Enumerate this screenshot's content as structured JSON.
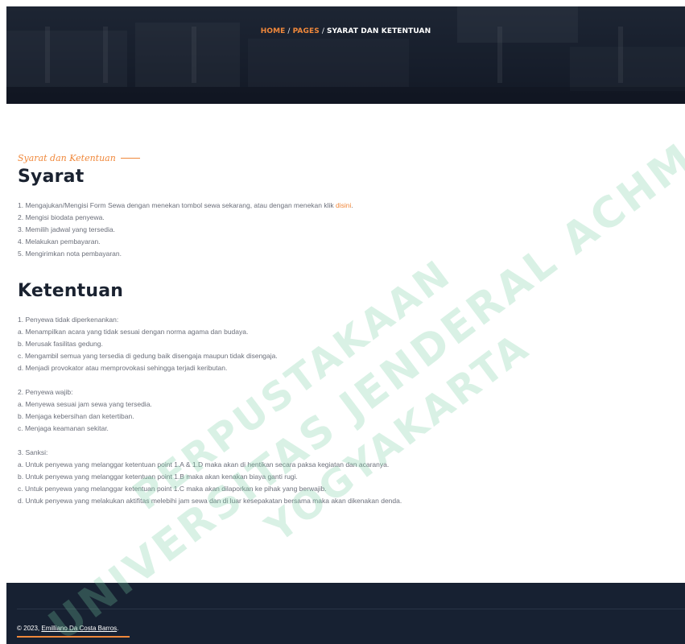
{
  "breadcrumb": {
    "home": "HOME",
    "pages": "PAGES",
    "separator": "/",
    "current": "SYARAT DAN KETENTUAN"
  },
  "subtitle": "Syarat dan Ketentuan",
  "syarat": {
    "title": "Syarat",
    "item1_text": "1. Mengajukan/Mengisi Form Sewa dengan menekan tombol sewa sekarang, atau dengan menekan klik ",
    "item1_link": "disini",
    "item1_end": ".",
    "items": [
      "2. Mengisi biodata penyewa.",
      "3. Memilih jadwal yang tersedia.",
      "4. Melakukan pembayaran.",
      "5. Mengirimkan nota pembayaran."
    ]
  },
  "ketentuan": {
    "title": "Ketentuan",
    "group1": [
      "1. Penyewa tidak diperkenankan:",
      "a. Menampilkan acara yang tidak sesuai dengan norma agama dan budaya.",
      "b. Merusak fasilitas gedung.",
      "c. Mengambil semua yang tersedia di gedung baik disengaja maupun tidak disengaja.",
      "d. Menjadi provokator atau memprovokasi sehingga terjadi keributan."
    ],
    "group2": [
      "2. Penyewa wajib:",
      "a. Menyewa sesuai jam sewa yang tersedia.",
      "b. Menjaga kebersihan dan ketertiban.",
      "c. Menjaga keamanan sekitar."
    ],
    "group3": [
      "3. Sanksi:",
      "a. Untuk penyewa yang melanggar ketentuan point 1.A & 1.D maka akan di hentikan secara paksa kegiatan dan acaranya.",
      "b. Untuk penyewa yang melanggar ketentuan point 1.B maka akan kenakan biaya ganti rugi.",
      "c. Untuk penyewa yang melanggar ketentuan point 1.C maka akan dilaporkan ke pihak yang berwajib.",
      "d. Untuk penyewa yang melakukan aktifitas melebihi jam sewa dan di luar kesepakatan bersama maka akan dikenakan denda."
    ]
  },
  "footer": {
    "copyright_prefix": "© 2023, ",
    "copyright_holder": "Emilliano Da Costa Barros",
    "copyright_suffix": "."
  },
  "watermark": {
    "line1": "PERPUSTAKAAN",
    "line2": "UNIVERSITAS JENDERAL ACHMAD YANI",
    "line3": "YOGYAKARTA"
  },
  "colors": {
    "accent": "#f0883b",
    "heading": "#1a2230",
    "body_text": "#6b6f7a",
    "footer_bg": "#172132",
    "hero_bg": "#1d2634"
  }
}
